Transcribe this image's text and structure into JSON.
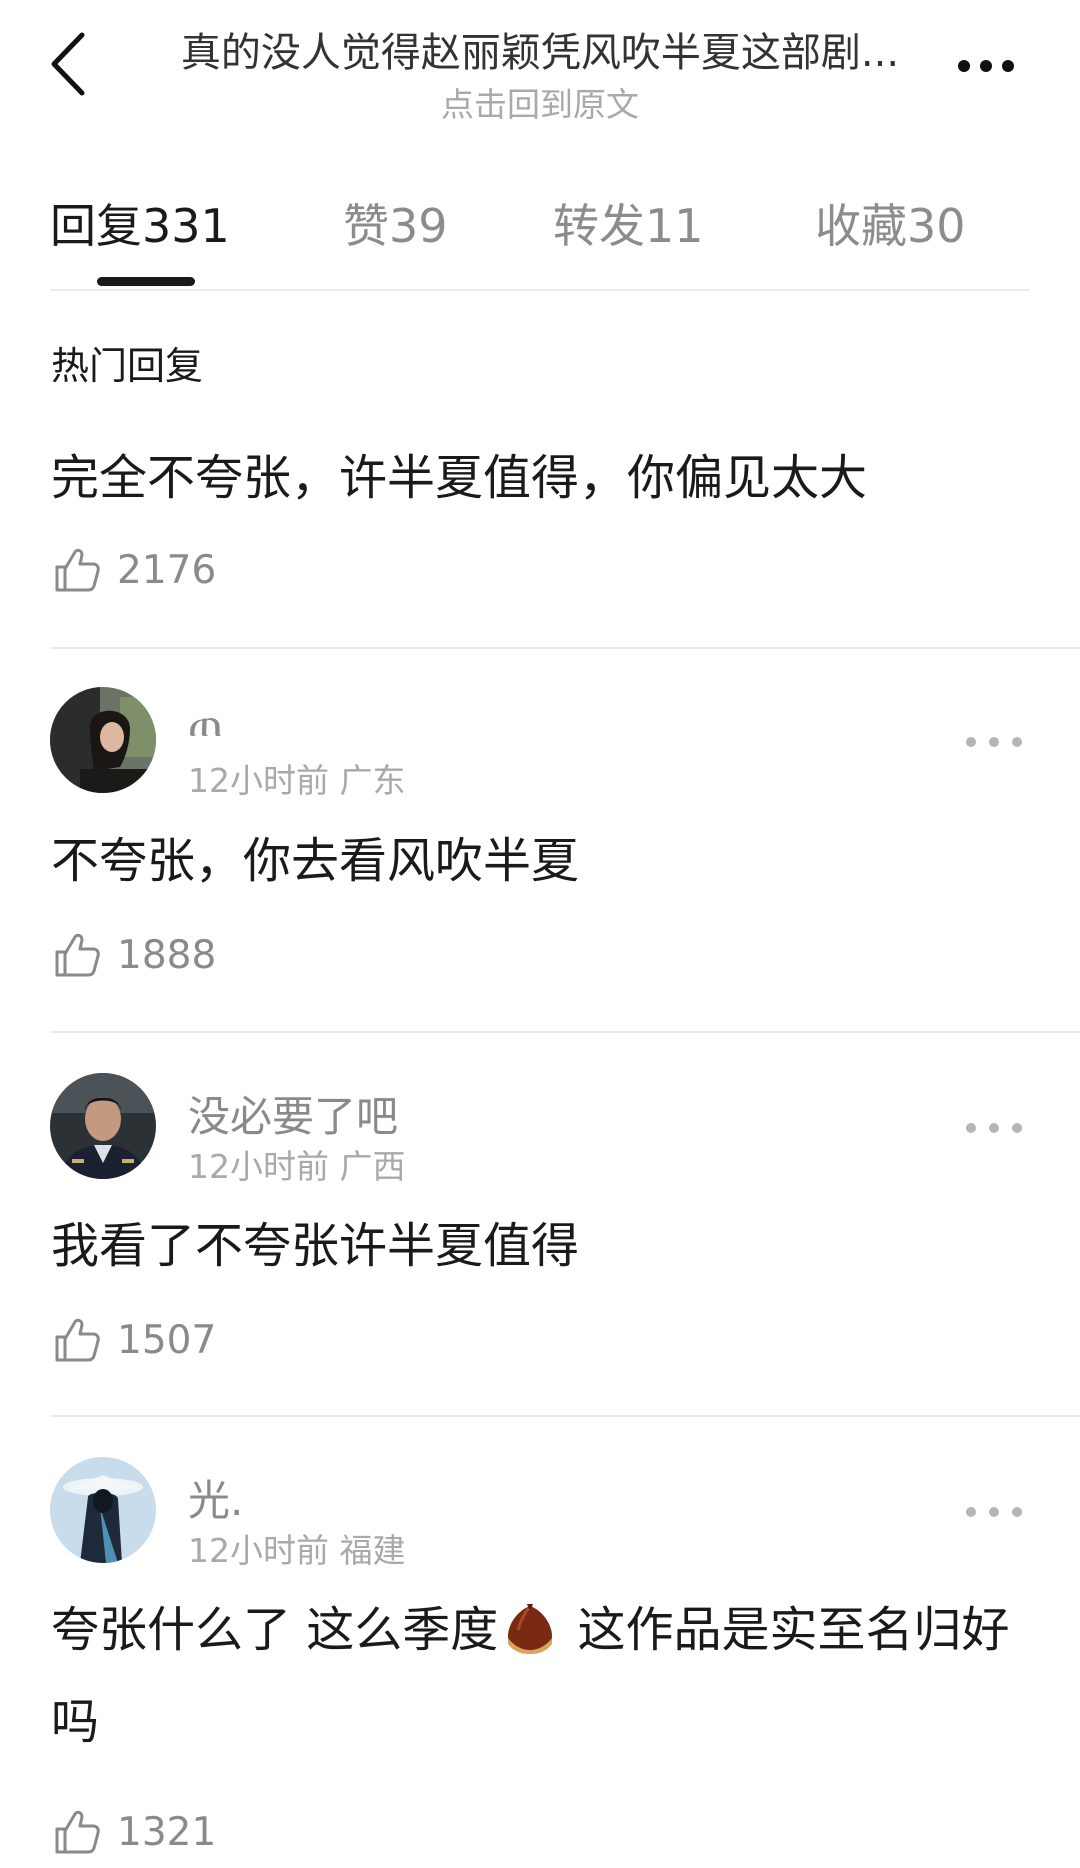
{
  "header": {
    "title": "真的没人觉得赵丽颖凭风吹半夏这部剧...",
    "subtitle": "点击回到原文"
  },
  "tabs": [
    {
      "label": "回复",
      "count": "331"
    },
    {
      "label": "赞",
      "count": "39"
    },
    {
      "label": "转发",
      "count": "11"
    },
    {
      "label": "收藏",
      "count": "30"
    }
  ],
  "hot": {
    "section_title": "热门回复",
    "text": "完全不夸张，许半夏值得，你偏见太大",
    "likes": "2176"
  },
  "comments": [
    {
      "username": "ጠ",
      "time": "12小时前",
      "location": "广东",
      "text": "不夸张，你去看风吹半夏",
      "likes": "1888"
    },
    {
      "username": "没必要了吧",
      "time": "12小时前",
      "location": "广西",
      "text": "我看了不夸张许半夏值得",
      "likes": "1507"
    },
    {
      "username": "光.",
      "time": "12小时前",
      "location": "福建",
      "text_before_emoji": "夸张什么了 这么季度",
      "text_after_emoji": " 这作品是实至名归好吗",
      "emoji": "chestnut-emoji",
      "likes": "1321"
    }
  ],
  "icons": {
    "back": "chevron-left-icon",
    "more": "more-horizontal-icon",
    "like": "thumbs-up-icon"
  },
  "colors": {
    "text_primary": "#1a1a1a",
    "text_secondary": "#8a8a8a",
    "text_tertiary": "#a9a9a9",
    "divider": "#ececec"
  }
}
